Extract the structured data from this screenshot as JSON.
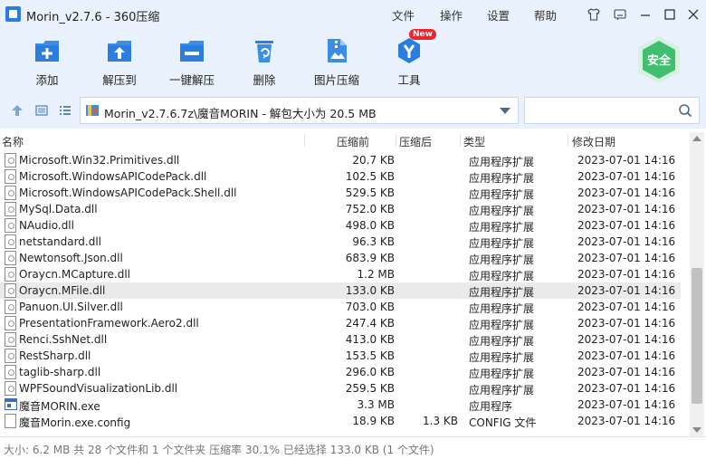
{
  "window": {
    "title": "Morin_v2.7.6 - 360压缩"
  },
  "menu": {
    "file": "文件",
    "action": "操作",
    "settings": "设置",
    "help": "帮助"
  },
  "toolbar": {
    "add": "添加",
    "extract_to": "解压到",
    "one_click_extract": "一键解压",
    "delete": "删除",
    "image_compress": "图片压缩",
    "tools": "工具",
    "new_badge": "New",
    "safe": "安全"
  },
  "address": {
    "path": "Morin_v2.7.6.7z\\魔音MORIN - 解包大小为 20.5 MB"
  },
  "columns": {
    "name": "名称",
    "size": "压缩前",
    "packed": "压缩后",
    "type": "类型",
    "modified": "修改日期"
  },
  "files": [
    {
      "name": "Microsoft.Win32.Primitives.dll",
      "size": "20.7 KB",
      "packed": "",
      "type": "应用程序扩展",
      "modified": "2023-07-01 14:16",
      "icon": "dll"
    },
    {
      "name": "Microsoft.WindowsAPICodePack.dll",
      "size": "102.5 KB",
      "packed": "",
      "type": "应用程序扩展",
      "modified": "2023-07-01 14:16",
      "icon": "dll"
    },
    {
      "name": "Microsoft.WindowsAPICodePack.Shell.dll",
      "size": "529.5 KB",
      "packed": "",
      "type": "应用程序扩展",
      "modified": "2023-07-01 14:16",
      "icon": "dll"
    },
    {
      "name": "MySql.Data.dll",
      "size": "752.0 KB",
      "packed": "",
      "type": "应用程序扩展",
      "modified": "2023-07-01 14:16",
      "icon": "dll"
    },
    {
      "name": "NAudio.dll",
      "size": "498.0 KB",
      "packed": "",
      "type": "应用程序扩展",
      "modified": "2023-07-01 14:16",
      "icon": "dll"
    },
    {
      "name": "netstandard.dll",
      "size": "96.3 KB",
      "packed": "",
      "type": "应用程序扩展",
      "modified": "2023-07-01 14:16",
      "icon": "dll"
    },
    {
      "name": "Newtonsoft.Json.dll",
      "size": "683.9 KB",
      "packed": "",
      "type": "应用程序扩展",
      "modified": "2023-07-01 14:16",
      "icon": "dll"
    },
    {
      "name": "Oraycn.MCapture.dll",
      "size": "1.2 MB",
      "packed": "",
      "type": "应用程序扩展",
      "modified": "2023-07-01 14:16",
      "icon": "dll"
    },
    {
      "name": "Oraycn.MFile.dll",
      "size": "133.0 KB",
      "packed": "",
      "type": "应用程序扩展",
      "modified": "2023-07-01 14:16",
      "icon": "dll",
      "selected": true
    },
    {
      "name": "Panuon.UI.Silver.dll",
      "size": "703.0 KB",
      "packed": "",
      "type": "应用程序扩展",
      "modified": "2023-07-01 14:16",
      "icon": "dll"
    },
    {
      "name": "PresentationFramework.Aero2.dll",
      "size": "247.4 KB",
      "packed": "",
      "type": "应用程序扩展",
      "modified": "2023-07-01 14:16",
      "icon": "dll"
    },
    {
      "name": "Renci.SshNet.dll",
      "size": "413.0 KB",
      "packed": "",
      "type": "应用程序扩展",
      "modified": "2023-07-01 14:16",
      "icon": "dll"
    },
    {
      "name": "RestSharp.dll",
      "size": "153.5 KB",
      "packed": "",
      "type": "应用程序扩展",
      "modified": "2023-07-01 14:16",
      "icon": "dll"
    },
    {
      "name": "taglib-sharp.dll",
      "size": "296.0 KB",
      "packed": "",
      "type": "应用程序扩展",
      "modified": "2023-07-01 14:16",
      "icon": "dll"
    },
    {
      "name": "WPFSoundVisualizationLib.dll",
      "size": "259.5 KB",
      "packed": "",
      "type": "应用程序扩展",
      "modified": "2023-07-01 14:16",
      "icon": "dll"
    },
    {
      "name": "魔音MORIN.exe",
      "size": "3.3 MB",
      "packed": "",
      "type": "应用程序",
      "modified": "2023-07-01 14:16",
      "icon": "exe"
    },
    {
      "name": "魔音Morin.exe.config",
      "size": "18.9 KB",
      "packed": "1.3 KB",
      "type": "CONFIG 文件",
      "modified": "2023-07-01 14:16",
      "icon": "config"
    }
  ],
  "status": {
    "text": "大小: 6.2 MB 共 28 个文件和 1 个文件夹 压缩率 30.1% 已经选择 133.0 KB (1 个文件)"
  },
  "colors": {
    "chrome_bg": "#e9f2fc",
    "accent": "#2b7de0",
    "safe_green": "#3fbf6f",
    "badge_red": "#e8262b",
    "selected_row": "#eaeaea"
  },
  "icons": {
    "app": "app-logo-icon",
    "skin": "tshirt-icon",
    "feedback": "feedback-icon",
    "minimize": "minimize-icon",
    "maximize": "maximize-icon",
    "close": "close-icon",
    "up": "up-arrow-icon",
    "view_thumb": "thumbnail-view-icon",
    "view_list": "list-view-icon",
    "search": "search-icon",
    "dropdown": "chevron-down-icon"
  }
}
